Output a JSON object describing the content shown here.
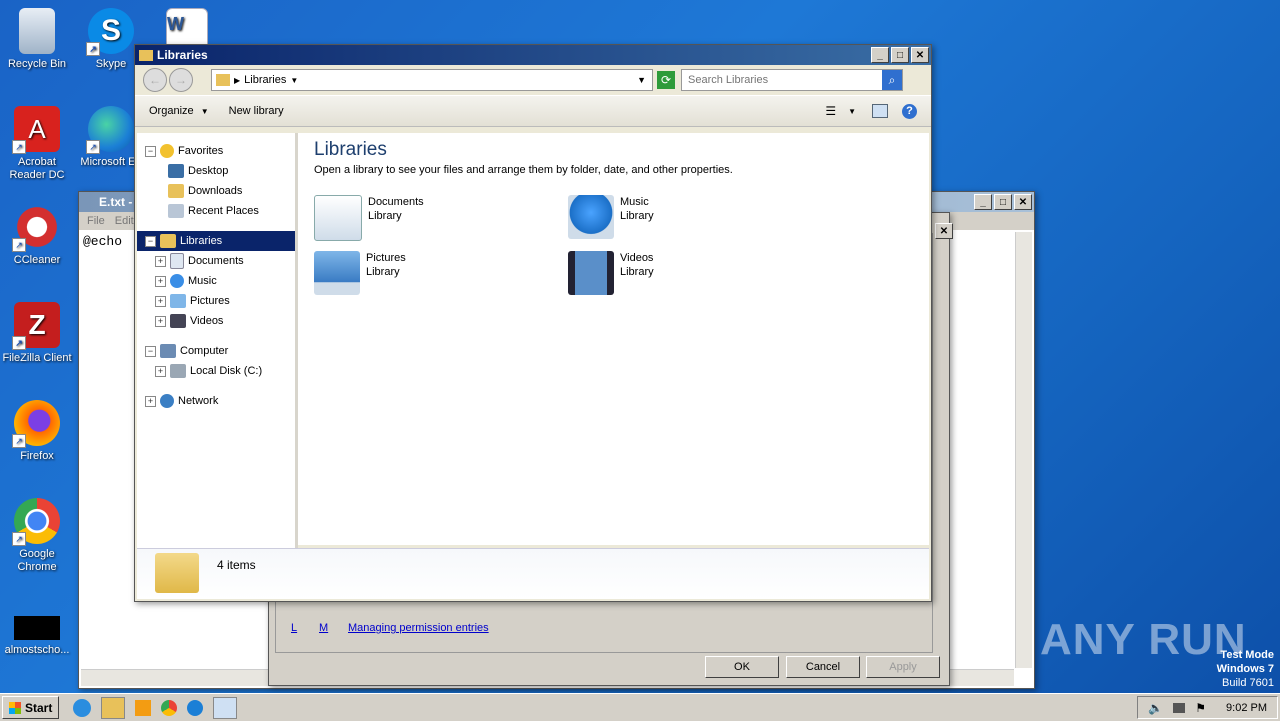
{
  "desktop": {
    "icons": [
      {
        "label": "Recycle Bin"
      },
      {
        "label": "Skype"
      },
      {
        "label": "Acrobat Reader DC"
      },
      {
        "label": "Microsoft Ed"
      },
      {
        "label": "CCleaner"
      },
      {
        "label": "FileZilla Client"
      },
      {
        "label": "Firefox"
      },
      {
        "label": "Google Chrome"
      },
      {
        "label": "almostscho..."
      }
    ],
    "watermark": "ANY RUN",
    "test_mode": {
      "line1": "Test Mode",
      "line2": "Windows 7",
      "line3": "Build 7601"
    }
  },
  "notepad": {
    "title": "E.txt -",
    "menu": {
      "file": "File",
      "edit": "Edit"
    },
    "content": "@echo "
  },
  "dialog": {
    "link1": "L",
    "link2": "M",
    "link3": "Managing permission entries",
    "ok": "OK",
    "cancel": "Cancel",
    "apply": "Apply"
  },
  "explorer": {
    "title": "Libraries",
    "address": "Libraries",
    "search_placeholder": "Search Libraries",
    "toolbar": {
      "organize": "Organize",
      "new_library": "New library"
    },
    "tree": {
      "favorites": "Favorites",
      "desktop": "Desktop",
      "downloads": "Downloads",
      "recent": "Recent Places",
      "libraries": "Libraries",
      "documents": "Documents",
      "music": "Music",
      "pictures": "Pictures",
      "videos": "Videos",
      "computer": "Computer",
      "local_disk": "Local Disk (C:)",
      "network": "Network"
    },
    "content": {
      "heading": "Libraries",
      "subtitle": "Open a library to see your files and arrange them by folder, date, and other properties.",
      "items": [
        {
          "name": "Documents",
          "type": "Library"
        },
        {
          "name": "Music",
          "type": "Library"
        },
        {
          "name": "Pictures",
          "type": "Library"
        },
        {
          "name": "Videos",
          "type": "Library"
        }
      ]
    },
    "status": "4 items"
  },
  "taskbar": {
    "start": "Start",
    "clock": "9:02 PM"
  }
}
